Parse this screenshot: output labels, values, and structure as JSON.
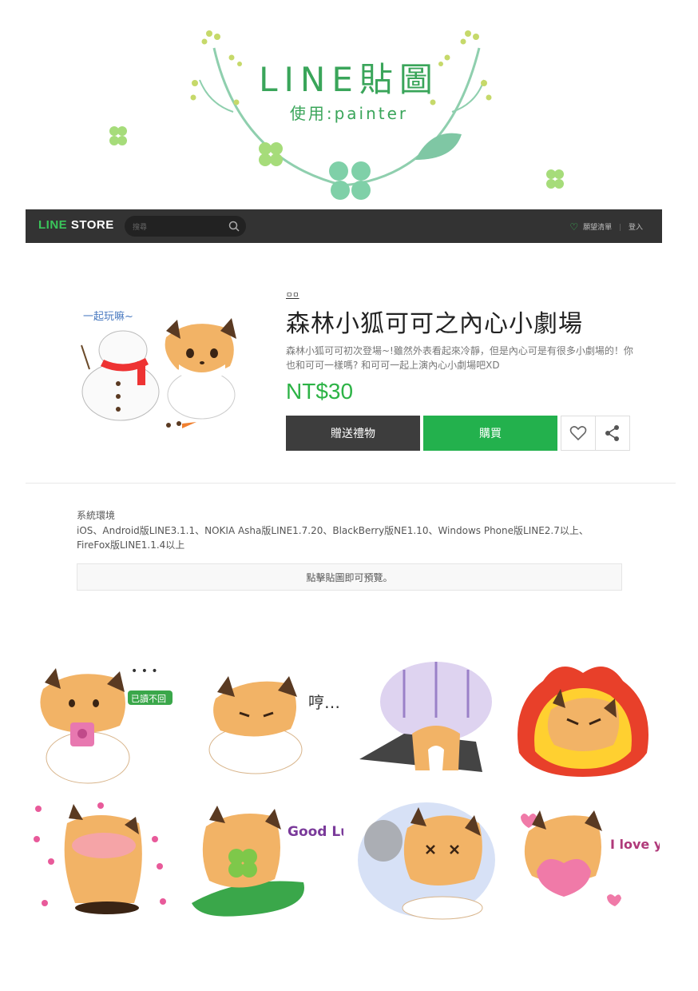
{
  "banner": {
    "title": "LINE貼圖",
    "subtitle": "使用:painter"
  },
  "storebar": {
    "logo_line": "LINE",
    "logo_store": " STORE",
    "search_placeholder": "搜尋",
    "wishlist_label": "願望清單",
    "login_label": "登入"
  },
  "product": {
    "breadcrumb": "ㅁㅁ",
    "title": "森林小狐可可之內心小劇場",
    "description": "森林小狐可可初次登場~!雖然外表看起來冷靜，但是內心可是有很多小劇場的！你也和可可一樣嗎? 和可可一起上演內心小劇場吧XD",
    "price": "NT$30",
    "gift_button": "贈送禮物",
    "buy_button": "購買",
    "image_caption": "一起玩嘛~"
  },
  "env": {
    "label": "系統環境",
    "text": "iOS、Android版LINE3.1.1、NOKIA Asha版LINE1.7.20、BlackBerry版NE1.10、Windows Phone版LINE2.7以上、FireFox版LINE1.1.4以上",
    "preview_hint": "點擊貼圖即可預覽。"
  },
  "stickers": [
    {
      "id": "waiting",
      "text": "已讀不回"
    },
    {
      "id": "hmph",
      "text": "哼…"
    },
    {
      "id": "gloom",
      "text": ""
    },
    {
      "id": "angry",
      "text": ""
    },
    {
      "id": "shy",
      "text": ""
    },
    {
      "id": "goodluck",
      "text": "Good Luck!"
    },
    {
      "id": "dizzy",
      "text": ""
    },
    {
      "id": "love",
      "text": "I love you"
    }
  ],
  "colors": {
    "accent": "#23b14d",
    "bar": "#333333",
    "gift": "#3d3d3d",
    "fox": "#f2b366",
    "fox_dark": "#5a3a22"
  }
}
